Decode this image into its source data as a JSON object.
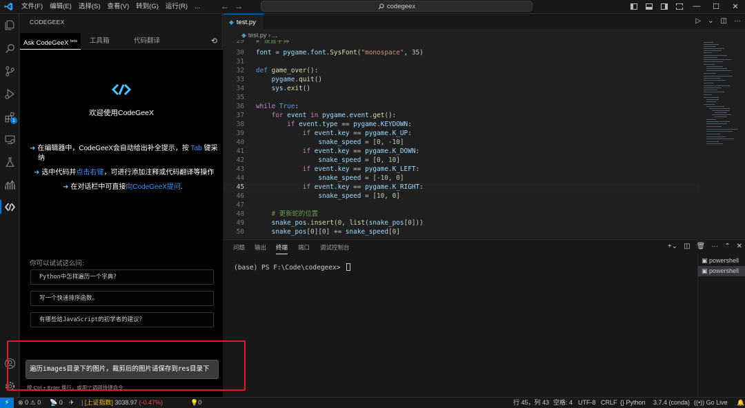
{
  "titlebar": {
    "menu": [
      "文件(F)",
      "编辑(E)",
      "选择(S)",
      "查看(V)",
      "转到(G)",
      "运行(R)",
      "..."
    ],
    "search": "codegeex"
  },
  "colors": {
    "accent": "#0078d4",
    "highlight_box": "#e01b24",
    "codegeex_cyan": "#4fc1ff"
  },
  "activity_bar": {
    "extensions_badge": "1"
  },
  "sidepanel": {
    "title": "CODEGEEX",
    "tabs": [
      {
        "label": "Ask CodeGeeX",
        "sup": "beta"
      },
      {
        "label": "工具箱"
      },
      {
        "label": "代码翻译"
      }
    ],
    "welcome": "欢迎使用CodeGeeX",
    "tip1_a": "在编辑器中，CodeGeeX会自动给出补全提示，按 ",
    "tip1_key": "Tab",
    "tip1_b": " 键采",
    "tip1_c": "纳",
    "tip2_a": "选中代码并",
    "tip2_link": "点击右键",
    "tip2_b": "，可进行添加注释或代码翻译等操作",
    "tip3_a": "在对话栏中可直接",
    "tip3_link": "向CodeGeeX提问",
    "tip3_b": ".",
    "try_label": "你可以试试这么问:",
    "suggestions": [
      "Python中怎样遍历一个字典？",
      "写一个快速排序函数。",
      "有哪些给JavaScript的初学者的建议？"
    ],
    "input_value": "遍历images目录下的图片，裁剪后的图片请保存到res目录下",
    "input_hint": "按 Ctrl + Enter 换行，或用\"/\"调用快捷命令"
  },
  "editor": {
    "tab_label": "test.py",
    "breadcrumb_file": "test.py",
    "breadcrumb_sep": " › ...",
    "lines": [
      "29",
      "30",
      "31",
      "32",
      "33",
      "34",
      "35",
      "36",
      "37",
      "38",
      "39",
      "40",
      "41",
      "42",
      "43",
      "44",
      "45",
      "46",
      "47",
      "48",
      "49",
      "50"
    ],
    "current_line": "45"
  },
  "panel": {
    "tabs": [
      "问题",
      "输出",
      "终端",
      "端口",
      "调试控制台"
    ],
    "active_tab": "终端",
    "terminal_prompt": "(base) PS F:\\Code\\codegeex> ",
    "terminals": [
      "powershell",
      "powershell"
    ]
  },
  "statusbar": {
    "errors": "0",
    "warnings": "0",
    "info": "0",
    "stock_name": "[上证指数]",
    "stock_value": "3038.97",
    "stock_change": "(-0.47%)",
    "bulb_count": "0",
    "position": "行 45，列 43",
    "spaces": "空格: 4",
    "encoding": "UTF-8",
    "eol": "CRLF",
    "language": "Python",
    "interpreter": "3.7.4 (conda)",
    "golive": "Go Live"
  }
}
